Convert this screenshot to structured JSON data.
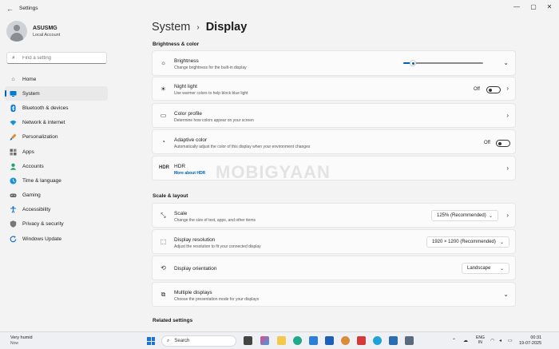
{
  "window": {
    "title": "Settings"
  },
  "profile": {
    "name": "ASUSMG",
    "account": "Local Account"
  },
  "search": {
    "placeholder": "Find a setting"
  },
  "nav": [
    {
      "label": "Home",
      "icon": "home-icon",
      "color": "#555555"
    },
    {
      "label": "System",
      "icon": "monitor-icon",
      "color": "#0078d4",
      "active": true
    },
    {
      "label": "Bluetooth & devices",
      "icon": "bluetooth-icon",
      "color": "#0078d4"
    },
    {
      "label": "Network & internet",
      "icon": "wifi-icon",
      "color": "#1a8fdc"
    },
    {
      "label": "Personalization",
      "icon": "brush-icon",
      "color": "#e08b2c"
    },
    {
      "label": "Apps",
      "icon": "apps-icon",
      "color": "#555555"
    },
    {
      "label": "Accounts",
      "icon": "person-icon",
      "color": "#2aa36b"
    },
    {
      "label": "Time & language",
      "icon": "globe-clock-icon",
      "color": "#1a8fdc"
    },
    {
      "label": "Gaming",
      "icon": "gamepad-icon",
      "color": "#666666"
    },
    {
      "label": "Accessibility",
      "icon": "accessibility-icon",
      "color": "#1a73d6"
    },
    {
      "label": "Privacy & security",
      "icon": "shield-icon",
      "color": "#777777"
    },
    {
      "label": "Windows Update",
      "icon": "update-icon",
      "color": "#1a73d6"
    }
  ],
  "breadcrumb": {
    "parent": "System",
    "current": "Display"
  },
  "sections": {
    "brightness_color": "Brightness & color",
    "scale_layout": "Scale & layout",
    "related": "Related settings"
  },
  "cards": {
    "brightness": {
      "title": "Brightness",
      "desc": "Change brightness for the built-in display",
      "level": 0.12
    },
    "night_light": {
      "title": "Night light",
      "desc": "Use warmer colors to help block blue light",
      "state": "Off"
    },
    "color_profile": {
      "title": "Color profile",
      "desc": "Determine how colors appear on your screen"
    },
    "adaptive_color": {
      "title": "Adaptive color",
      "desc": "Automatically adjust the color of this display when your environment changes",
      "state": "Off"
    },
    "hdr": {
      "title": "HDR",
      "link": "More about HDR"
    },
    "scale": {
      "title": "Scale",
      "desc": "Change the size of text, apps, and other items",
      "value": "125% (Recommended)"
    },
    "resolution": {
      "title": "Display resolution",
      "desc": "Adjust the resolution to fit your connected display",
      "value": "1920 × 1200 (Recommended)"
    },
    "orientation": {
      "title": "Display orientation",
      "value": "Landscape"
    },
    "multiple": {
      "title": "Multiple displays",
      "desc": "Choose the presentation mode for your displays"
    }
  },
  "watermark": "MOBIGYAAN",
  "taskbar": {
    "weather_title": "Very humid",
    "weather_sub": "Now",
    "search_label": "Search",
    "lang_top": "ENG",
    "lang_bottom": "IN",
    "time": "00:31",
    "date": "19-07-2025"
  }
}
